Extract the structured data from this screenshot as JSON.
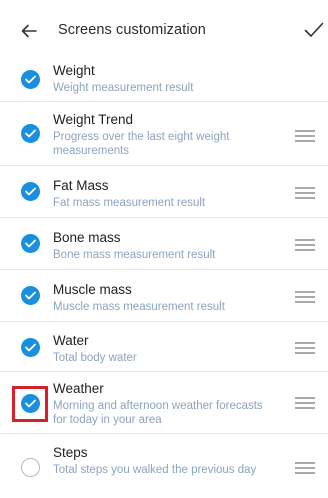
{
  "header": {
    "title": "Screens customization",
    "back_icon": "arrow-left-icon",
    "confirm_icon": "checkmark-icon"
  },
  "colors": {
    "accent": "#1a8fe0",
    "subtitle": "#8da3bf",
    "highlight": "#d6202a"
  },
  "items": [
    {
      "title": "Weight",
      "subtitle": "Weight measurement result",
      "checked": true
    },
    {
      "title": "Weight Trend",
      "subtitle": "Progress over the last eight weight measurements",
      "checked": true
    },
    {
      "title": "Fat Mass",
      "subtitle": "Fat mass measurement result",
      "checked": true
    },
    {
      "title": "Bone mass",
      "subtitle": "Bone mass measurement result",
      "checked": true
    },
    {
      "title": "Muscle mass",
      "subtitle": "Muscle mass measurement result",
      "checked": true
    },
    {
      "title": "Water",
      "subtitle": "Total body water",
      "checked": true
    },
    {
      "title": "Weather",
      "subtitle": "Morning and afternoon weather forecasts for today in your area",
      "checked": true
    },
    {
      "title": "Steps",
      "subtitle": "Total steps you walked the previous day",
      "checked": false
    }
  ]
}
